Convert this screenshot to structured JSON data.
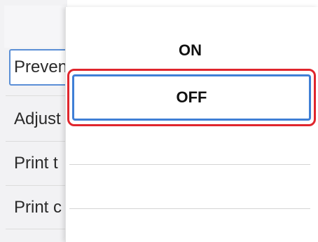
{
  "background_list": {
    "items": [
      {
        "label": "Preven",
        "selected": true
      },
      {
        "label": "Adjust"
      },
      {
        "label": "Print t"
      },
      {
        "label": "Print c"
      }
    ]
  },
  "popup": {
    "options": [
      {
        "label": "ON",
        "selected": false
      },
      {
        "label": "OFF",
        "selected": true
      }
    ]
  },
  "colors": {
    "highlight_outline": "#e0262d",
    "selection_border": "#3f7fd6"
  }
}
